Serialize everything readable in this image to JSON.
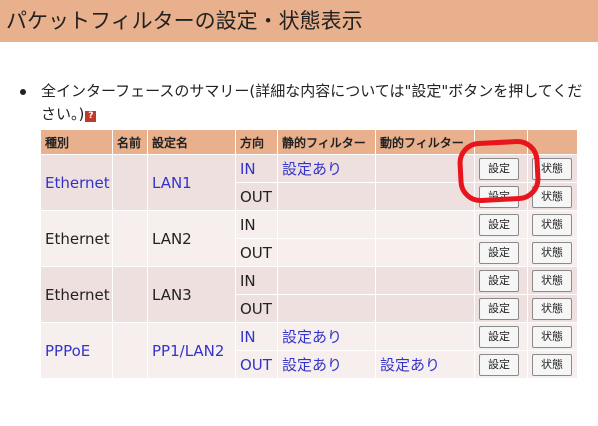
{
  "header": {
    "title": "パケットフィルターの設定・状態表示"
  },
  "summary": {
    "text": "全インターフェースのサマリー(詳細な内容については\"設定\"ボタンを押してください。)",
    "help_icon": "?"
  },
  "table": {
    "headers": [
      "種別",
      "名前",
      "設定名",
      "方向",
      "静的フィルター",
      "動的フィルター",
      "",
      ""
    ],
    "rows": [
      {
        "type": "Ethernet",
        "setting_name": "LAN1",
        "in_static": "設定あり",
        "out_static": "",
        "out_dynamic": "",
        "link": true
      },
      {
        "type": "Ethernet",
        "setting_name": "LAN2",
        "in_static": "",
        "out_static": "",
        "out_dynamic": "",
        "link": false
      },
      {
        "type": "Ethernet",
        "setting_name": "LAN3",
        "in_static": "",
        "out_static": "",
        "out_dynamic": "",
        "link": false
      },
      {
        "type": "PPPoE",
        "setting_name": "PP1/LAN2",
        "in_static": "設定あり",
        "out_static": "設定あり",
        "out_dynamic": "設定あり",
        "link": true
      }
    ],
    "dir_in": "IN",
    "dir_out": "OUT",
    "settings_button": "設定",
    "status_button": "状態"
  },
  "colors": {
    "header_bg": "#e8b08c",
    "link": "#3333cc",
    "annotation": "#e8141e"
  }
}
